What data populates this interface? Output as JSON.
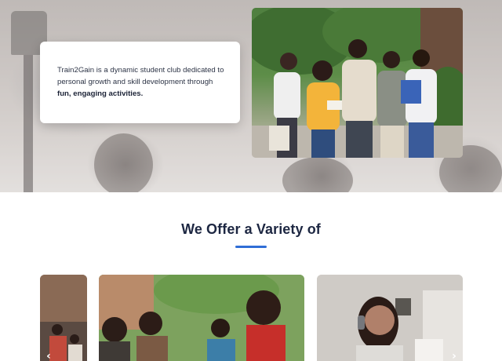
{
  "hero": {
    "intro_text_prefix": "Train2Gain is a dynamic student club dedicated to personal growth and skill development through ",
    "intro_text_emphasis": "fun, engaging activities.",
    "photo_subject": "group-of-students-photo"
  },
  "offer_section": {
    "title": "We Offer a Variety of",
    "accent_color": "#2f6ed6"
  },
  "carousel": {
    "cards": [
      {
        "subject": "students-at-desk-photo"
      },
      {
        "subject": "students-group-laughing-photo"
      },
      {
        "subject": "student-with-headphones-photo"
      }
    ],
    "prev_icon": "‹",
    "next_icon": "›"
  },
  "colors": {
    "heading": "#1d2742",
    "body_text": "#2d3446",
    "accent": "#2f6ed6"
  }
}
